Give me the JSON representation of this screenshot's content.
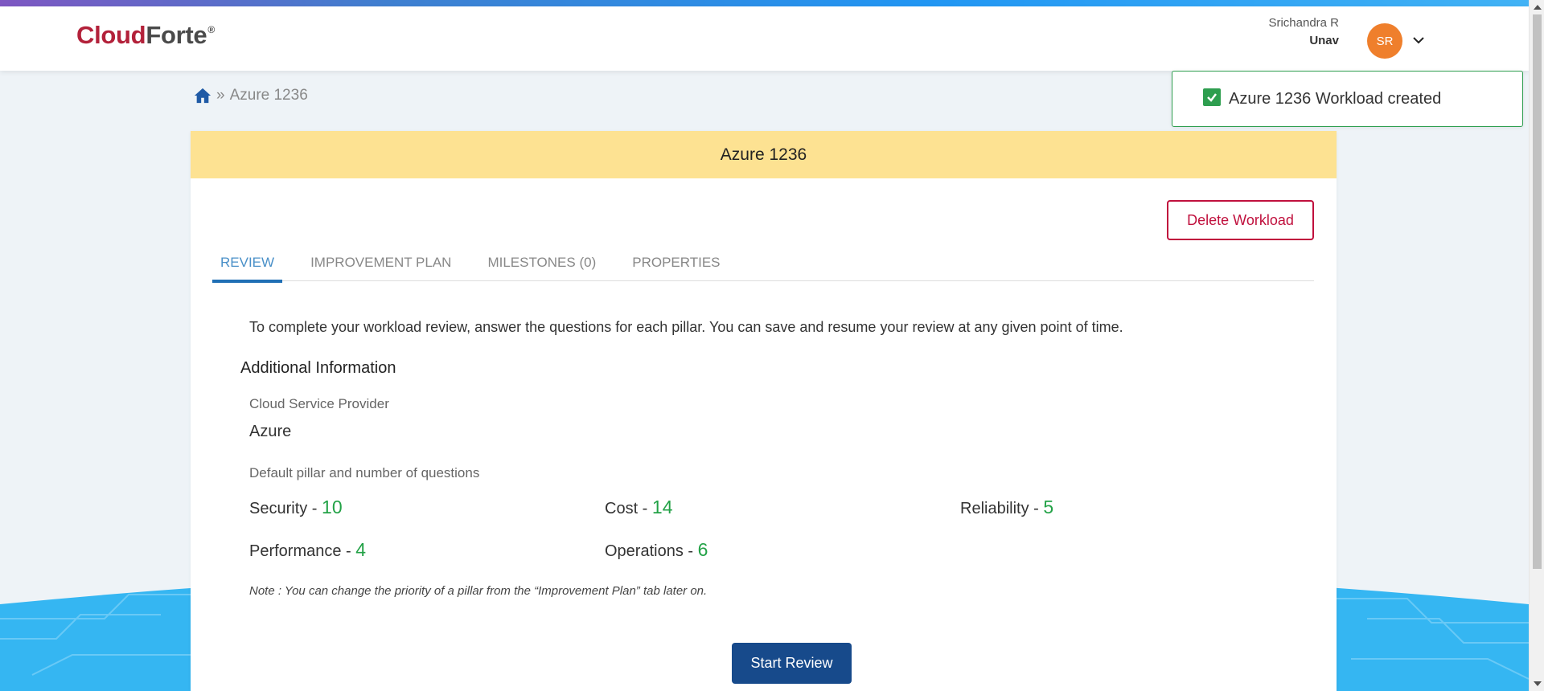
{
  "brand": {
    "name_part1": "Cloud",
    "name_part2": "Forte",
    "mark": "®"
  },
  "user": {
    "name": "Srichandra R",
    "org": "Unav",
    "initials": "SR",
    "avatar_color": "#ef7f2c"
  },
  "breadcrumb": {
    "separator": "»",
    "current": "Azure 1236"
  },
  "toast": {
    "message": "Azure 1236 Workload created",
    "icon": "check-square-icon"
  },
  "workload": {
    "title": "Azure 1236",
    "delete_label": "Delete Workload"
  },
  "tabs": [
    {
      "label": "REVIEW",
      "active": true
    },
    {
      "label": "IMPROVEMENT PLAN",
      "active": false
    },
    {
      "label": "MILESTONES (0)",
      "active": false
    },
    {
      "label": "PROPERTIES",
      "active": false
    }
  ],
  "review": {
    "intro": "To complete your workload review, answer the questions for each pillar. You can save and resume your review at any given point of time.",
    "section_title": "Additional Information",
    "provider_label": "Cloud Service Provider",
    "provider_value": "Azure",
    "pillars_label": "Default pillar and number of questions",
    "pillars": [
      {
        "name": "Security",
        "count": "10"
      },
      {
        "name": "Cost",
        "count": "14"
      },
      {
        "name": "Reliability",
        "count": "5"
      },
      {
        "name": "Performance",
        "count": "4"
      },
      {
        "name": "Operations",
        "count": "6"
      }
    ],
    "note": "Note : You can change the priority of a pillar from the “Improvement Plan” tab later on.",
    "start_label": "Start Review"
  },
  "colors": {
    "brand_red": "#b3213a",
    "header_band": "#fde292",
    "delete_red": "#c0103d",
    "active_tab": "#1f6fb5",
    "count_green": "#23a247",
    "primary_button": "#174a8b"
  }
}
